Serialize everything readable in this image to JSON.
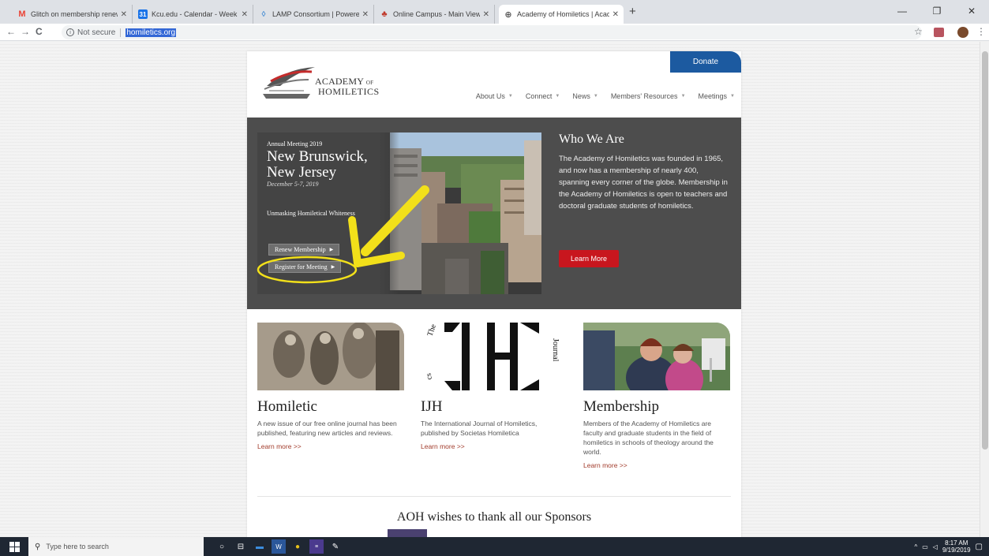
{
  "browser": {
    "tabs": [
      {
        "title": "Glitch on membership renewal p",
        "favicon": "gmail-icon",
        "color": "#ea4335"
      },
      {
        "title": "Kcu.edu - Calendar - Week of Se",
        "favicon": "calendar-icon",
        "color": "#1a73e8"
      },
      {
        "title": "LAMP Consortium | Powered by",
        "favicon": "lamp-icon",
        "color": "#4a8fd4"
      },
      {
        "title": "Online Campus - Main View | Ho",
        "favicon": "campus-icon",
        "color": "#c0392b"
      },
      {
        "title": "Academy of Homiletics | Academ",
        "favicon": "globe-icon",
        "color": "#555555"
      }
    ],
    "active_tab": 4,
    "security_label": "Not secure",
    "url": "homiletics.org"
  },
  "site": {
    "donate_label": "Donate",
    "logo": {
      "line1": "ACADEMY",
      "line1_small": "OF",
      "line2": "HOMILETICS"
    },
    "nav": [
      "About Us",
      "Connect",
      "News",
      "Members' Resources",
      "Meetings"
    ],
    "hero": {
      "kicker": "Annual Meeting 2019",
      "city": "New Brunswick, New Jersey",
      "dates": "December 5-7, 2019",
      "theme": "Unmasking Homiletical Whiteness",
      "renew_label": "Renew Membership",
      "register_label": "Register for Meeting"
    },
    "who": {
      "title": "Who We Are",
      "body": "The Academy of Homiletics was founded in 1965, and now has a membership of nearly 400, spanning every corner of the globe. Membership in the Academy of Homiletics is open to teachers and doctoral graduate students of homiletics.",
      "button": "Learn More"
    },
    "columns": [
      {
        "title": "Homiletic",
        "body": "A new issue of our free online journal has been published, featuring new articles and reviews.",
        "link": "Learn more >>"
      },
      {
        "title": "IJH",
        "body": "The International Journal of Homiletics, published by Societas Homiletica",
        "link": "Learn more >>"
      },
      {
        "title": "Membership",
        "body": "Members of the Academy of Homiletics are faculty and graduate students in the field of homiletics in schools of theology around the world.",
        "link": "Learn more >>"
      }
    ],
    "ijh_ring_text_left": "The",
    "ijh_ring_text_right": "Journal",
    "ijh_ring_text_bottom": "cs",
    "sponsors_title": "AOH wishes to thank all our Sponsors"
  },
  "taskbar": {
    "search_placeholder": "Type here to search",
    "time": "8:17 AM",
    "date": "9/19/2019"
  },
  "colors": {
    "donate": "#1c5aa0",
    "learn_more_button": "#c8161e",
    "hero_bg": "#4d4d4d",
    "annotation": "#f2e01a"
  }
}
